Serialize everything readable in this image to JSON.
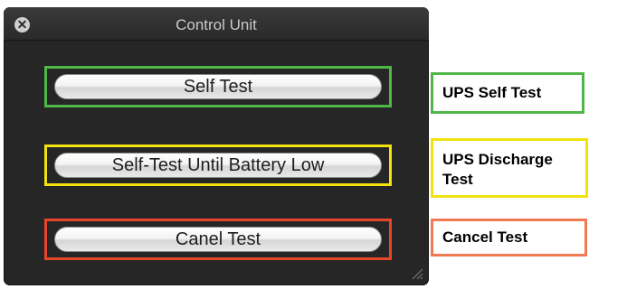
{
  "window": {
    "title": "Control Unit"
  },
  "buttons": {
    "self_test": "Self Test",
    "self_test_battery_low": "Self-Test Until Battery Low",
    "cancel_test": "Canel Test"
  },
  "callouts": {
    "self_test": "UPS Self Test",
    "discharge_test": "UPS Discharge Test",
    "cancel_test": "Cancel Test"
  },
  "colors": {
    "green": "#4fb748",
    "yellow": "#f2e20e",
    "red": "#e5462a",
    "window_bg": "#262626"
  },
  "icons": {
    "close": "close-icon",
    "resize": "resize-grip-icon"
  }
}
